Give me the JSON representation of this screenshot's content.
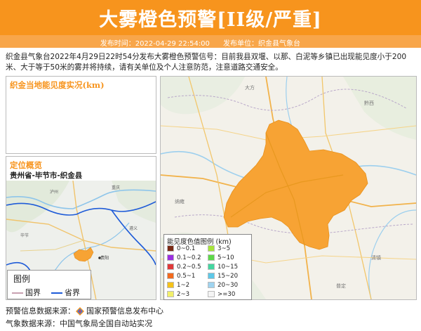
{
  "header": {
    "title": "大雾橙色预警[II级/严重]",
    "publish_time_label": "发布时间：",
    "publish_time": "2022-04-29 22:54:00",
    "publisher_label": "发布单位：",
    "publisher": "织金县气象台"
  },
  "bulletin": "织金县气象台2022年4月29日22时54分发布大雾橙色预警信号：目前我县双堰、以那、白泥等乡镇已出现能见度小于200米、大于等于50米的雾并将持续，请有关单位及个人注意防范，注意道路交通安全。",
  "visibility_panel": {
    "title": "织金当地能见度实况(km)"
  },
  "location_panel": {
    "title": "定位概览",
    "path": "贵州省-毕节市-织金县",
    "city_label": "贵阳",
    "legend": {
      "title": "图例",
      "items": [
        {
          "label": "国界",
          "color": "#c8a0b0"
        },
        {
          "label": "省界",
          "color": "#1e5bd8"
        }
      ]
    }
  },
  "main_map": {
    "warning_area_color": "#f7a334",
    "legend": {
      "title": "能见度色值图例 (km)",
      "items": [
        {
          "label": "0~0.1",
          "color": "#7a2a16"
        },
        {
          "label": "3~5",
          "color": "#a6e43a"
        },
        {
          "label": "0.1~0.2",
          "color": "#9b30e0"
        },
        {
          "label": "5~10",
          "color": "#5ed84a"
        },
        {
          "label": "0.2~0.5",
          "color": "#e03a3a"
        },
        {
          "label": "10~15",
          "color": "#44d6a0"
        },
        {
          "label": "0.5~1",
          "color": "#f26a1e"
        },
        {
          "label": "15~20",
          "color": "#5ec8e8"
        },
        {
          "label": "1~2",
          "color": "#f5c21a"
        },
        {
          "label": "20~30",
          "color": "#9fd4f0"
        },
        {
          "label": "2~3",
          "color": "#f2f06a"
        },
        {
          "label": ">=30",
          "color": "#f4f4f4"
        }
      ]
    }
  },
  "sources": {
    "warning_label": "预警信息数据来源：",
    "warning_source": "国家预警信息发布中心",
    "weather_label": "气象数据来源：",
    "weather_source": "中国气象局全国自动站实况"
  }
}
